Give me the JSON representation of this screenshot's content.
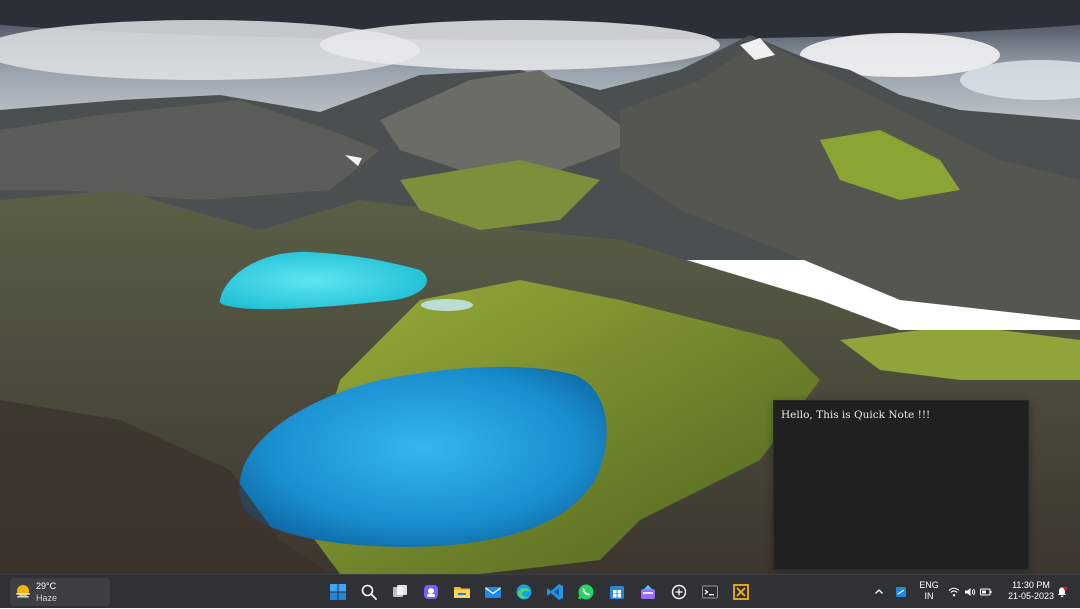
{
  "note": {
    "text": "Hello, This is Quick Note !!!"
  },
  "weather": {
    "temperature": "29°C",
    "condition": "Haze",
    "icon": "sun-haze-icon"
  },
  "taskbar": {
    "apps": [
      {
        "name": "start",
        "icon": "windows-logo-icon"
      },
      {
        "name": "search",
        "icon": "search-icon"
      },
      {
        "name": "task-view",
        "icon": "task-view-icon"
      },
      {
        "name": "teams-chat",
        "icon": "chat-icon"
      },
      {
        "name": "file-explorer",
        "icon": "folder-icon"
      },
      {
        "name": "mail",
        "icon": "mail-icon"
      },
      {
        "name": "edge",
        "icon": "edge-browser-icon"
      },
      {
        "name": "vscode",
        "icon": "code-editor-icon"
      },
      {
        "name": "whatsapp",
        "icon": "whatsapp-icon"
      },
      {
        "name": "store",
        "icon": "store-icon"
      },
      {
        "name": "visual-studio-installer",
        "icon": "installer-icon"
      },
      {
        "name": "chatgpt",
        "icon": "ai-chat-icon"
      },
      {
        "name": "terminal",
        "icon": "terminal-icon"
      },
      {
        "name": "app-tool",
        "icon": "tool-app-icon"
      }
    ]
  },
  "tray": {
    "lang_primary": "ENG",
    "lang_secondary": "IN",
    "time": "11:30 PM",
    "date": "21-05-2023"
  },
  "colors": {
    "taskbar_bg": "#1e2024",
    "note_bg": "#202020",
    "accent_blue": "#0078d4"
  }
}
